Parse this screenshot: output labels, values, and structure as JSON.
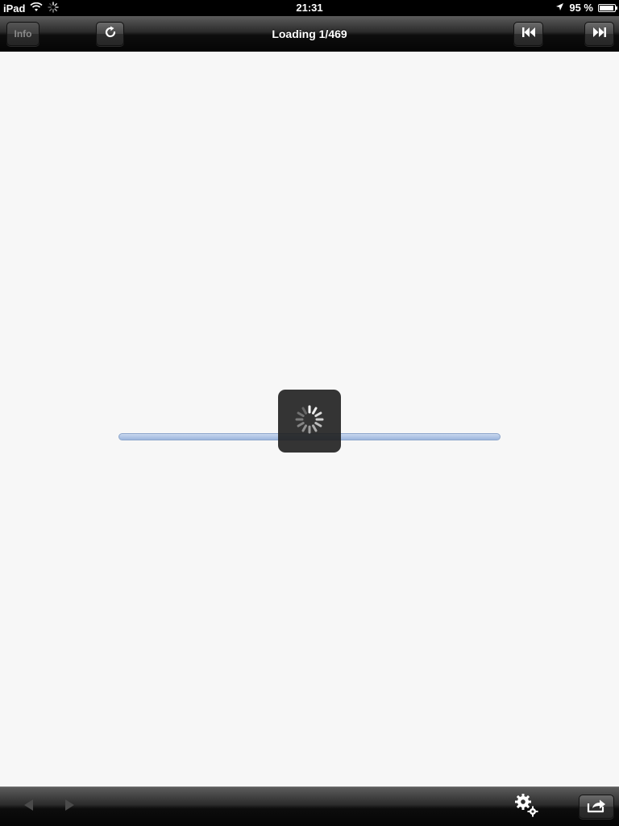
{
  "status_bar": {
    "device": "iPad",
    "time": "21:31",
    "battery_percent": "95 %",
    "battery_level": 0.95
  },
  "toolbar": {
    "title": "Loading 1/469",
    "info_label": "Info",
    "icons": {
      "refresh": "refresh-icon",
      "first": "skip-to-start-icon",
      "last": "skip-to-end-icon"
    }
  },
  "loading": {
    "progress": 0.0,
    "spinner": "activity-spinner-icon"
  },
  "bottom_bar": {
    "icons": {
      "back": "back-arrow-icon",
      "forward": "forward-arrow-icon",
      "settings": "gear-icon",
      "share": "share-icon"
    }
  },
  "colors": {
    "toolbar": "#1a1a1a",
    "background": "#f7f7f7",
    "progress_track": "#adc3e6",
    "hud": "#1e1e1e"
  }
}
